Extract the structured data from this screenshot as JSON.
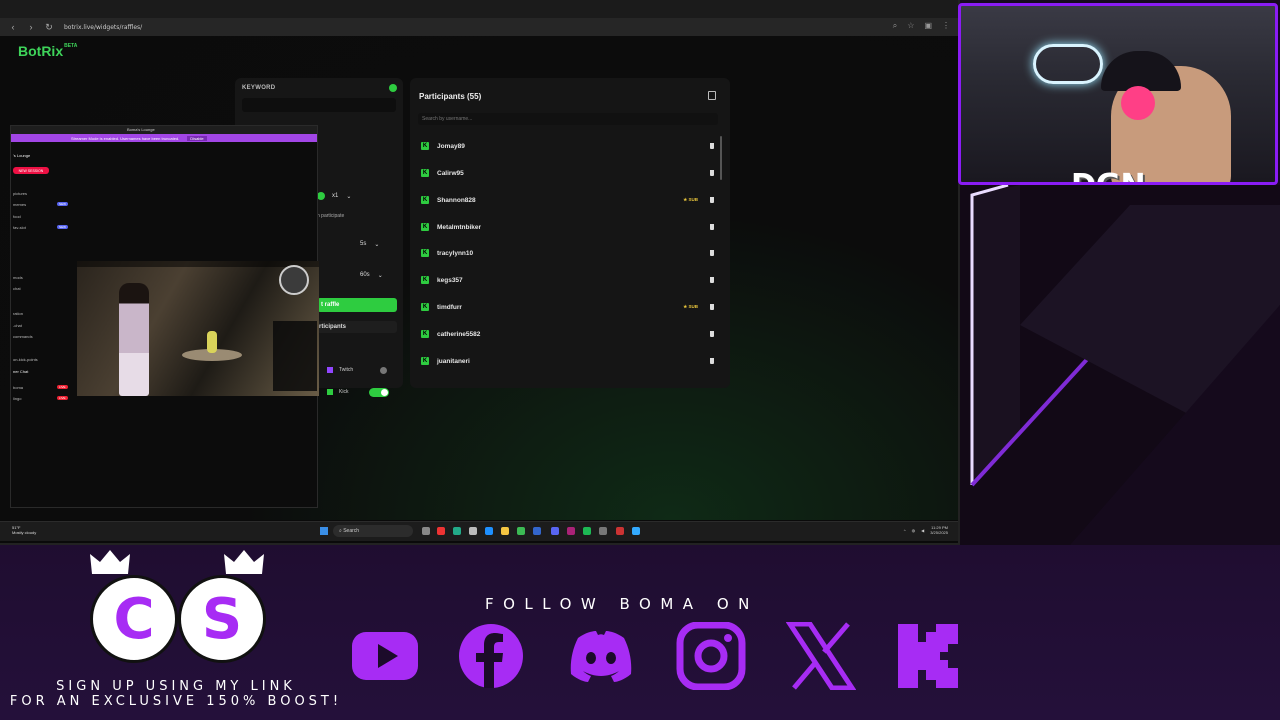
{
  "browser": {
    "url": "botrix.live/widgets/raffles/"
  },
  "app": {
    "logo": "BotRix",
    "logo_badge": "BETA"
  },
  "raffle_settings": {
    "keyword_label": "KEYWORD",
    "multiplier": "x1",
    "participate_label": "n participate",
    "timer_short": "5s",
    "timer_long": "60s",
    "start_button": "t raffle",
    "participants_button": "rticipants",
    "platforms": [
      {
        "name": "Twitch",
        "enabled": false
      },
      {
        "name": "Kick",
        "enabled": true
      }
    ]
  },
  "participants": {
    "title": "Participants (55)",
    "search_placeholder": "Search by username...",
    "list": [
      {
        "name": "Jomay89",
        "badge": ""
      },
      {
        "name": "Calirw95",
        "badge": ""
      },
      {
        "name": "Shannon828",
        "badge": "★ SUB"
      },
      {
        "name": "Metalmtnbiker",
        "badge": ""
      },
      {
        "name": "tracylynn10",
        "badge": ""
      },
      {
        "name": "kegs357",
        "badge": ""
      },
      {
        "name": "timdfurr",
        "badge": "★ SUB"
      },
      {
        "name": "catherine5582",
        "badge": ""
      },
      {
        "name": "juanitaneri",
        "badge": ""
      }
    ]
  },
  "streamer_window": {
    "title": "Boma's Lounge",
    "banner": "Streamer Mode is enabled. Usernames have been truncated.",
    "dismiss": "Disable",
    "server": "'s Lounge",
    "new_session": "NEW SESSION",
    "sidebar_items": [
      {
        "label": "pictures",
        "tag": ""
      },
      {
        "label": "memes",
        "tag": "NEW"
      },
      {
        "label": "food",
        "tag": ""
      },
      {
        "label": "fav-slot",
        "tag": "NEW"
      },
      {
        "label": "mods",
        "tag": ""
      },
      {
        "label": "chat",
        "tag": ""
      },
      {
        "label": "ration",
        "tag": ""
      },
      {
        "label": "-chat",
        "tag": ""
      },
      {
        "label": "commands",
        "tag": ""
      },
      {
        "label": "on-kick-points",
        "tag": ""
      },
      {
        "label": "ner Chat",
        "tag": ""
      },
      {
        "label": "boma",
        "tag": "LIVE"
      },
      {
        "label": "lingo",
        "tag": "LIVE"
      }
    ]
  },
  "taskbar": {
    "weather_temp": "51°F",
    "weather_desc": "Mostly cloudy",
    "search": "Search",
    "time": "11:29 PM",
    "date": "3/25/2025"
  },
  "webcam": {
    "tag": "DGN"
  },
  "promo": {
    "line1": "SIGN UP USING MY LINK",
    "line2": "FOR AN EXCLUSIVE 150% BOOST!",
    "letter_c": "C",
    "letter_s": "S"
  },
  "follow": {
    "text": "FOLLOW BOMA ON",
    "socials": [
      "youtube-icon",
      "facebook-icon",
      "discord-icon",
      "instagram-icon",
      "x-icon",
      "kick-icon"
    ]
  },
  "colors": {
    "accent_purple": "#a72cf4",
    "botrix_green": "#2ecc40",
    "sub_gold": "#e6c33b"
  }
}
